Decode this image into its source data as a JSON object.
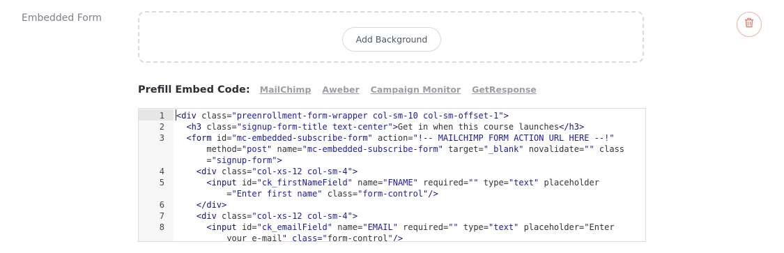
{
  "field": {
    "label": "Embedded Form"
  },
  "background": {
    "add_label": "Add Background"
  },
  "delete": {
    "icon": "trash-icon",
    "color": "#e07b66"
  },
  "prefill": {
    "title": "Prefill Embed Code:",
    "providers": [
      "MailChimp",
      "Aweber",
      "Campaign Monitor",
      "GetResponse"
    ]
  },
  "editor": {
    "lines": [
      {
        "num": "1",
        "text": "<div class=\"preenrollment-form-wrapper col-sm-10 col-sm-offset-1\">"
      },
      {
        "num": "2",
        "text": "  <h3 class=\"signup-form-title text-center\">Get in when this course launches</h3>"
      },
      {
        "num": "3",
        "text": "  <form id=\"mc-embedded-subscribe-form\" action=\"!-- MAILCHIMP FORM ACTION URL HERE --!\""
      },
      {
        "num": "",
        "text": "      method=\"post\" name=\"mc-embedded-subscribe-form\" target=\"_blank\" novalidate=\"\" class"
      },
      {
        "num": "",
        "text": "      =\"signup-form\">"
      },
      {
        "num": "4",
        "text": "    <div class=\"col-xs-12 col-sm-4\">"
      },
      {
        "num": "5",
        "text": "      <input id=\"ck_firstNameField\" name=\"FNAME\" required=\"\" type=\"text\" placeholder"
      },
      {
        "num": "",
        "text": "          =\"Enter first name\" class=\"form-control\"/>"
      },
      {
        "num": "6",
        "text": "    </div>"
      },
      {
        "num": "7",
        "text": "    <div class=\"col-xs-12 col-sm-4\">"
      },
      {
        "num": "8",
        "text": "      <input id=\"ck_emailField\" name=\"EMAIL\" required=\"\" type=\"text\" placeholder=\"Enter"
      },
      {
        "num": "",
        "text": "          your e-mail\" class=\"form-control\"/>"
      }
    ]
  }
}
